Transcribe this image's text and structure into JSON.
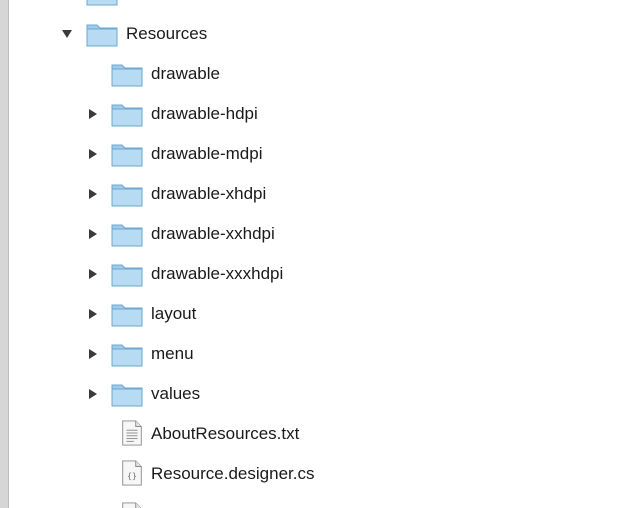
{
  "tree": {
    "parent": {
      "label": "Resources",
      "expanded": true
    },
    "children": [
      {
        "label": "drawable",
        "type": "folder",
        "has_children": false
      },
      {
        "label": "drawable-hdpi",
        "type": "folder",
        "has_children": true
      },
      {
        "label": "drawable-mdpi",
        "type": "folder",
        "has_children": true
      },
      {
        "label": "drawable-xhdpi",
        "type": "folder",
        "has_children": true
      },
      {
        "label": "drawable-xxhdpi",
        "type": "folder",
        "has_children": true
      },
      {
        "label": "drawable-xxxhdpi",
        "type": "folder",
        "has_children": true
      },
      {
        "label": "layout",
        "type": "folder",
        "has_children": true
      },
      {
        "label": "menu",
        "type": "folder",
        "has_children": true
      },
      {
        "label": "values",
        "type": "folder",
        "has_children": true
      },
      {
        "label": "AboutResources.txt",
        "type": "text-file",
        "has_children": false
      },
      {
        "label": "Resource.designer.cs",
        "type": "code-file",
        "has_children": false
      }
    ]
  },
  "colors": {
    "folder_fill": "#a9d3ef",
    "folder_tab": "#8cc2e6",
    "folder_outline": "#6ea7cf",
    "disclosure": "#3a3a3a"
  }
}
